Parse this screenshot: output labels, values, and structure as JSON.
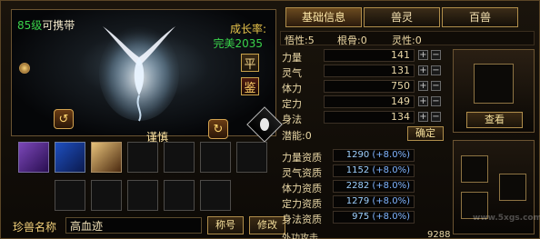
{
  "pet": {
    "level_text": "85级",
    "carry_text": "可携带",
    "growth_title": "成长率:",
    "growth_value": "完美2035",
    "trait": "谨慎",
    "ping_label": "平",
    "jian_label": "鉴",
    "name_label": "珍兽名称",
    "name_value": "高血迹",
    "title_button": "称号",
    "rename_button": "修改"
  },
  "tabs": [
    {
      "label": "基础信息"
    },
    {
      "label": "兽灵"
    },
    {
      "label": "百兽"
    }
  ],
  "top_stats": [
    {
      "label": "悟性:5"
    },
    {
      "label": "根骨:0"
    },
    {
      "label": "灵性:0"
    }
  ],
  "stats": [
    {
      "label": "力量",
      "value": "141"
    },
    {
      "label": "灵气",
      "value": "131"
    },
    {
      "label": "体力",
      "value": "750"
    },
    {
      "label": "定力",
      "value": "149"
    },
    {
      "label": "身法",
      "value": "134"
    }
  ],
  "potential": {
    "label": "潜能:0",
    "confirm_button": "确定"
  },
  "aptitudes": [
    {
      "label": "力量资质",
      "value": "1290",
      "pct": "(+8.0%)"
    },
    {
      "label": "灵气资质",
      "value": "1152",
      "pct": "(+8.0%)"
    },
    {
      "label": "体力资质",
      "value": "2282",
      "pct": "(+8.0%)"
    },
    {
      "label": "定力资质",
      "value": "1279",
      "pct": "(+8.0%)"
    },
    {
      "label": "身法资质",
      "value": "975",
      "pct": "(+8.0%)"
    }
  ],
  "attack": {
    "label": "外功攻击",
    "value": "9288"
  },
  "right_panel": {
    "view_button": "查看"
  },
  "watermark": "www.5xgs.com",
  "icons": {
    "rank": "rank-badge-icon",
    "rotate_left": "rotate-left-icon",
    "rotate_right": "rotate-right-icon",
    "egg": "egg-icon"
  }
}
